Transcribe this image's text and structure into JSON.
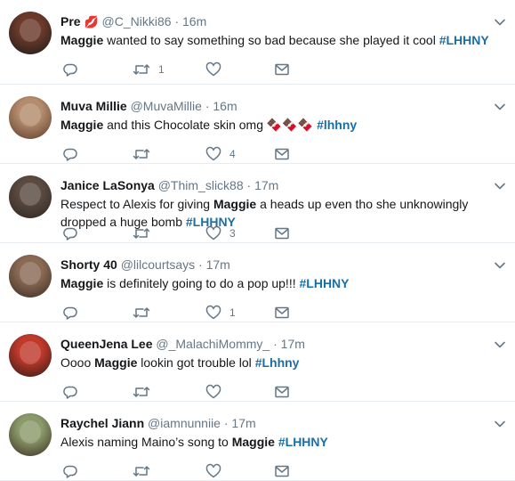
{
  "tweets": [
    {
      "name": "Pre",
      "name_emoji": "💋",
      "handle": "@C_Nikki86",
      "time": "16m",
      "text": [
        {
          "t": "Maggie",
          "kind": "kw"
        },
        {
          "t": " wanted to say something so bad because she played it cool ",
          "kind": "plain"
        },
        {
          "t": "#LHHNY",
          "kind": "tag"
        }
      ],
      "retweets": "1",
      "likes": "",
      "avatar_colors": [
        "#6b3a2a",
        "#1a1a1a"
      ]
    },
    {
      "name": "Muva Millie",
      "name_emoji": "",
      "handle": "@MuvaMillie",
      "time": "16m",
      "text": [
        {
          "t": "Maggie",
          "kind": "kw"
        },
        {
          "t": " and this Chocolate skin omg ",
          "kind": "plain"
        },
        {
          "t": "🍫🍫🍫",
          "kind": "plain"
        },
        {
          "t": " #lhhny",
          "kind": "tag"
        }
      ],
      "retweets": "",
      "likes": "4",
      "avatar_colors": [
        "#b38b6d",
        "#5c3a28"
      ]
    },
    {
      "name": "Janice LaSonya",
      "name_emoji": "",
      "handle": "@Thim_slick88",
      "time": "17m",
      "text": [
        {
          "t": "Respect to Alexis for giving ",
          "kind": "plain"
        },
        {
          "t": "Maggie",
          "kind": "kw"
        },
        {
          "t": " a heads up even tho she unknowingly",
          "kind": "plain"
        },
        {
          "t": "\ndropped a huge bomb ",
          "kind": "plain"
        },
        {
          "t": "#LHHNY",
          "kind": "tag"
        }
      ],
      "retweets": "",
      "likes": "3",
      "avatar_colors": [
        "#5a4a40",
        "#2c241f"
      ]
    },
    {
      "name": "Shorty 40",
      "name_emoji": "",
      "handle": "@lilcourtsays",
      "time": "17m",
      "text": [
        {
          "t": "Maggie",
          "kind": "kw"
        },
        {
          "t": " is definitely going to do a pop up!!! ",
          "kind": "plain"
        },
        {
          "t": "#LHHNY",
          "kind": "tag"
        }
      ],
      "retweets": "",
      "likes": "1",
      "avatar_colors": [
        "#8a6a55",
        "#3a2a20"
      ]
    },
    {
      "name": "QueenJena Lee",
      "name_emoji": "",
      "handle": "@_MalachiMommy_",
      "time": "17m",
      "text": [
        {
          "t": "Oooo ",
          "kind": "plain"
        },
        {
          "t": "Maggie",
          "kind": "kw"
        },
        {
          "t": " lookin got trouble lol ",
          "kind": "plain"
        },
        {
          "t": "#Lhhny",
          "kind": "tag"
        }
      ],
      "retweets": "",
      "likes": "",
      "avatar_colors": [
        "#c0392b",
        "#2b1a14"
      ]
    },
    {
      "name": "Raychel Jiann",
      "name_emoji": "",
      "handle": "@iamnunniie",
      "time": "17m",
      "text": [
        {
          "t": "Alexis naming Maino’s song to ",
          "kind": "plain"
        },
        {
          "t": "Maggie",
          "kind": "kw"
        },
        {
          "t": " ",
          "kind": "plain"
        },
        {
          "t": "#LHHNY",
          "kind": "tag"
        }
      ],
      "retweets": "",
      "likes": "",
      "avatar_colors": [
        "#8a9a6a",
        "#3b2b22"
      ]
    }
  ],
  "icons": {
    "reply": "reply-icon",
    "retweet": "retweet-icon",
    "like": "heart-icon",
    "dm": "envelope-icon",
    "caret": "chevron-down-icon"
  },
  "colors": {
    "hashtag": "#1b6ea5",
    "muted": "#657786",
    "divider": "#e6ecf0"
  }
}
